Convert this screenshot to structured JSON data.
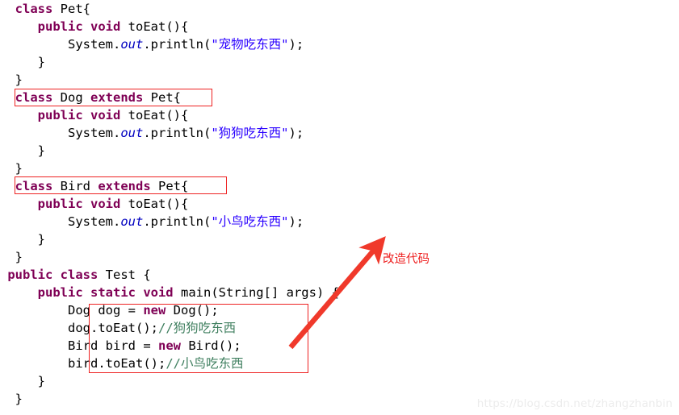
{
  "editor": {
    "language": "java",
    "colors": {
      "keyword": "#7f0055",
      "string": "#2a00ff",
      "field": "#0000c0",
      "comment": "#3f7f5f",
      "plain": "#000000",
      "annotation": "#ee2222",
      "background": "#ffffff"
    },
    "lines": [
      {
        "indent": 2,
        "tokens": [
          {
            "t": "kw",
            "v": "class"
          },
          {
            "t": "plain",
            "v": " Pet{"
          }
        ]
      },
      {
        "indent": 5,
        "tokens": [
          {
            "t": "kw",
            "v": "public void"
          },
          {
            "t": "plain",
            "v": " toEat(){"
          }
        ]
      },
      {
        "indent": 9,
        "tokens": [
          {
            "t": "plain",
            "v": "System."
          },
          {
            "t": "fld",
            "v": "out"
          },
          {
            "t": "plain",
            "v": ".println("
          },
          {
            "t": "str",
            "v": "\"宠物吃东西\""
          },
          {
            "t": "plain",
            "v": ");"
          }
        ]
      },
      {
        "indent": 5,
        "tokens": [
          {
            "t": "plain",
            "v": "}"
          }
        ]
      },
      {
        "indent": 2,
        "tokens": [
          {
            "t": "plain",
            "v": "}"
          }
        ]
      },
      {
        "indent": 2,
        "tokens": [
          {
            "t": "kw",
            "v": "class"
          },
          {
            "t": "plain",
            "v": " Dog "
          },
          {
            "t": "kw",
            "v": "extends"
          },
          {
            "t": "plain",
            "v": " Pet{"
          }
        ]
      },
      {
        "indent": 5,
        "tokens": [
          {
            "t": "kw",
            "v": "public void"
          },
          {
            "t": "plain",
            "v": " toEat(){"
          }
        ]
      },
      {
        "indent": 9,
        "tokens": [
          {
            "t": "plain",
            "v": "System."
          },
          {
            "t": "fld",
            "v": "out"
          },
          {
            "t": "plain",
            "v": ".println("
          },
          {
            "t": "str",
            "v": "\"狗狗吃东西\""
          },
          {
            "t": "plain",
            "v": ");"
          }
        ]
      },
      {
        "indent": 5,
        "tokens": [
          {
            "t": "plain",
            "v": "}"
          }
        ]
      },
      {
        "indent": 2,
        "tokens": [
          {
            "t": "plain",
            "v": "}"
          }
        ]
      },
      {
        "indent": 2,
        "tokens": [
          {
            "t": "kw",
            "v": "class"
          },
          {
            "t": "plain",
            "v": " Bird "
          },
          {
            "t": "kw",
            "v": "extends"
          },
          {
            "t": "plain",
            "v": " Pet{"
          }
        ]
      },
      {
        "indent": 5,
        "tokens": [
          {
            "t": "kw",
            "v": "public void"
          },
          {
            "t": "plain",
            "v": " toEat(){"
          }
        ]
      },
      {
        "indent": 9,
        "tokens": [
          {
            "t": "plain",
            "v": "System."
          },
          {
            "t": "fld",
            "v": "out"
          },
          {
            "t": "plain",
            "v": ".println("
          },
          {
            "t": "str",
            "v": "\"小鸟吃东西\""
          },
          {
            "t": "plain",
            "v": ");"
          }
        ]
      },
      {
        "indent": 5,
        "tokens": [
          {
            "t": "plain",
            "v": "}"
          }
        ]
      },
      {
        "indent": 2,
        "tokens": [
          {
            "t": "plain",
            "v": "}"
          }
        ]
      },
      {
        "indent": 1,
        "tokens": [
          {
            "t": "kw",
            "v": "public class"
          },
          {
            "t": "plain",
            "v": " Test {"
          }
        ]
      },
      {
        "indent": 5,
        "tokens": [
          {
            "t": "kw",
            "v": "public static void"
          },
          {
            "t": "plain",
            "v": " main(String[] args) {"
          }
        ]
      },
      {
        "indent": 9,
        "tokens": [
          {
            "t": "plain",
            "v": "Dog dog = "
          },
          {
            "t": "kw",
            "v": "new"
          },
          {
            "t": "plain",
            "v": " Dog();"
          }
        ]
      },
      {
        "indent": 9,
        "tokens": [
          {
            "t": "plain",
            "v": "dog.toEat();"
          },
          {
            "t": "cmt",
            "v": "//狗狗吃东西"
          }
        ]
      },
      {
        "indent": 9,
        "tokens": [
          {
            "t": "plain",
            "v": "Bird bird = "
          },
          {
            "t": "kw",
            "v": "new"
          },
          {
            "t": "plain",
            "v": " Bird();"
          }
        ]
      },
      {
        "indent": 9,
        "tokens": [
          {
            "t": "plain",
            "v": "bird.toEat();"
          },
          {
            "t": "cmt",
            "v": "//小鸟吃东西"
          }
        ]
      },
      {
        "indent": 5,
        "tokens": [
          {
            "t": "plain",
            "v": "}"
          }
        ]
      },
      {
        "indent": 2,
        "tokens": [
          {
            "t": "plain",
            "v": "}"
          }
        ]
      }
    ]
  },
  "annotations": {
    "label": "改造代码",
    "highlight_boxes": [
      {
        "name": "class-dog-declaration",
        "text": "class Dog extends Pet{"
      },
      {
        "name": "class-bird-declaration",
        "text": "class Bird extends Pet{"
      },
      {
        "name": "main-method-body",
        "text": "Dog dog = new Dog(); dog.toEat(); Bird bird = new Bird(); bird.toEat();"
      }
    ],
    "arrow": {
      "name": "callout-arrow",
      "from": "main-method-body",
      "to": "改造代码"
    }
  },
  "watermark": {
    "text": "https://blog.csdn.net/zhangzhanbin"
  }
}
